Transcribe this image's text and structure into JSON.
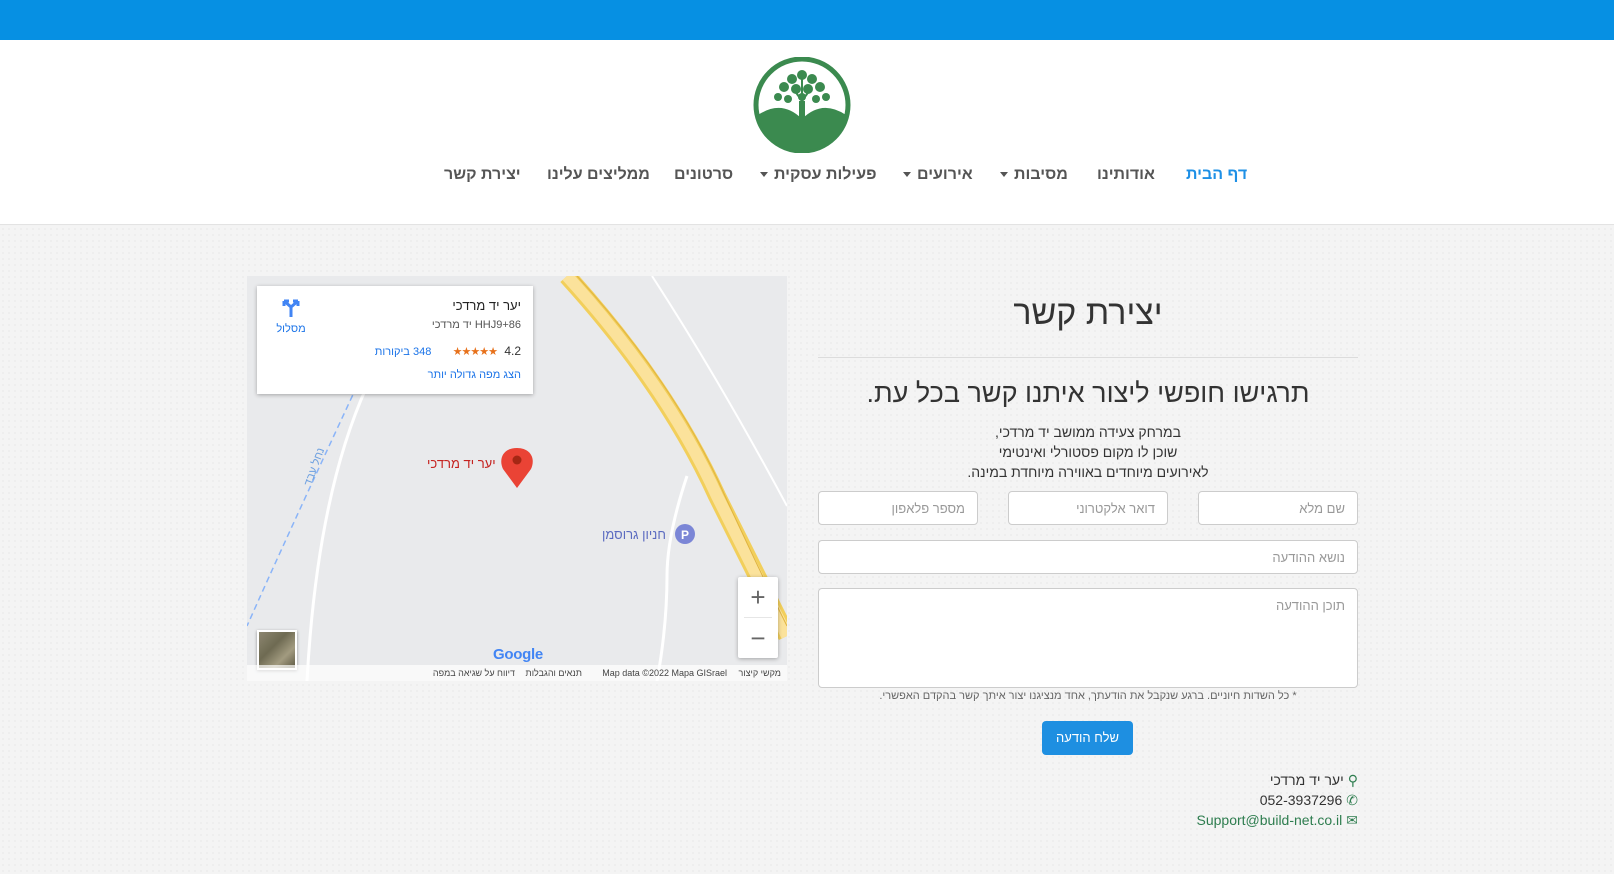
{
  "colors": {
    "topbar": "#0690e3",
    "brand_green": "#2e7d4f",
    "link_blue": "#1e90e6"
  },
  "nav": {
    "items": [
      {
        "label": "דף הבית",
        "active": true
      },
      {
        "label": "אודותינו"
      },
      {
        "label": "מסיבות",
        "dropdown": true
      },
      {
        "label": "אירועים",
        "dropdown": true
      },
      {
        "label": "פעילות עסקית",
        "dropdown": true
      },
      {
        "label": "סרטונים"
      },
      {
        "label": "ממליצים עלינו"
      },
      {
        "label": "יצירת קשר"
      }
    ]
  },
  "map": {
    "card": {
      "title": "יער יד מרדכי",
      "code": "HHJ9+86 יד מרדכי",
      "rating": "4.2",
      "stars": "★★★★★",
      "reviews": "348 ביקורות",
      "larger_map": "הצג מפה גדולה יותר",
      "directions": "מסלול"
    },
    "pin_label": "יער יד מרדכי",
    "parking_label": "חניון גרוסמן",
    "parking_icon": "P",
    "stream_label": "נחל עבד",
    "zoom_in": "+",
    "zoom_out": "−",
    "google": "Google",
    "attribution": {
      "shortcuts": "מקשי קיצור",
      "mapdata": "Map data ©2022 Mapa GISrael",
      "terms": "תנאים והגבלות",
      "report": "דיווח על שגיאה במפה"
    }
  },
  "contact": {
    "title": "יצירת קשר",
    "subtitle": "תרגישו חופשי ליצור איתנו קשר בכל עת.",
    "desc_lines": [
      "במרחק צעידה ממושב יד מרדכי,",
      "שוכן לו מקום פסטורלי ואינטימי",
      "לאירועים מיוחדים באווירה מיוחדת במינה."
    ],
    "fields": {
      "name": "שם מלא",
      "email": "דואר אלקטרוני",
      "phone": "מספר פלאפון",
      "subject": "נושא ההודעה",
      "message": "תוכן ההודעה"
    },
    "note": "* כל השדות חיוניים. ברגע שנקבל את הודעתך, אחד מנציגנו יצור איתך קשר בהקדם האפשרי.",
    "send": "שלח הודעה",
    "info": {
      "place": "יער יד מרדכי",
      "phone": "052-3937296",
      "email": "Support@build-net.co.il"
    }
  }
}
